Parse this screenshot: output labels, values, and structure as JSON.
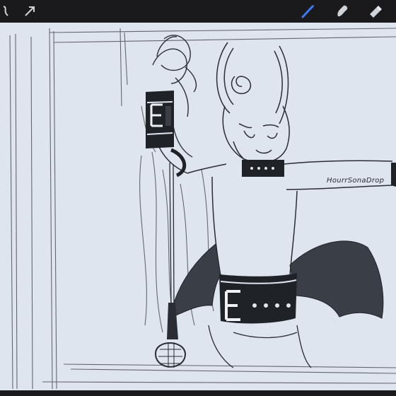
{
  "toolbar": {
    "tools": [
      {
        "name": "adjustments",
        "icon": "magic-wand-icon"
      },
      {
        "name": "transform",
        "icon": "arrow-cursor-icon"
      },
      {
        "name": "brush",
        "icon": "brush-icon",
        "active": true
      },
      {
        "name": "smudge",
        "icon": "smudge-icon"
      },
      {
        "name": "eraser",
        "icon": "eraser-icon"
      }
    ]
  },
  "canvas": {
    "signature": "HourrSonaDrop"
  },
  "colors": {
    "toolbar_bg": "#1a1a1c",
    "active_tool": "#3b7bf5",
    "canvas_bg": "#dfe5ee",
    "ink": "#23262c"
  }
}
